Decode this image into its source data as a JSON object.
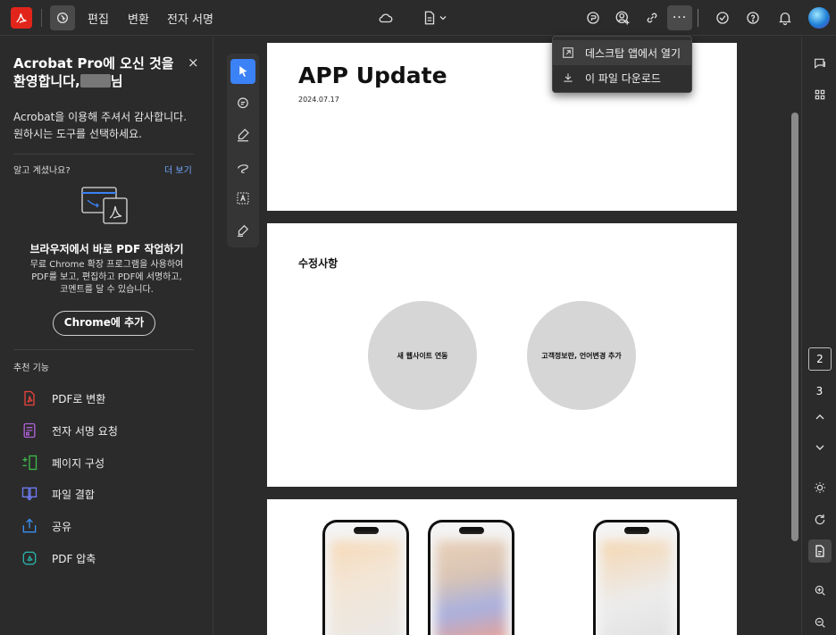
{
  "topbar": {
    "menu": [
      "편집",
      "변환",
      "전자 서명"
    ]
  },
  "dropdown": {
    "items": [
      "데스크탑 앱에서 열기",
      "이 파일 다운로드"
    ]
  },
  "left_panel": {
    "title_line1": "Acrobat Pro에 오신 것을",
    "title_line2_prefix": "환영합니다,",
    "title_line2_suffix": "님",
    "close": "×",
    "subtitle_line1": "Acrobat을 이용해 주셔서 감사합니다.",
    "subtitle_line2": "원하시는 도구를 선택하세요.",
    "did_you_know": "알고 계셨나요?",
    "see_more": "더 보기",
    "promo_title": "브라우저에서 바로 PDF 작업하기",
    "promo_line1": "무료 Chrome 확장 프로그램을 사용하여",
    "promo_line2": "PDF를 보고, 편집하고 PDF에 서명하고,",
    "promo_line3": "코멘트를 달 수 있습니다.",
    "chrome_button": "Chrome에 추가",
    "recommended_label": "추천 기능",
    "tools": [
      {
        "label": "PDF로 변환",
        "icon": "pdf-convert-icon",
        "color": "#e8453c"
      },
      {
        "label": "전자 서명 요청",
        "icon": "esign-request-icon",
        "color": "#b062d8"
      },
      {
        "label": "페이지 구성",
        "icon": "organize-pages-icon",
        "color": "#3fb84a"
      },
      {
        "label": "파일 결합",
        "icon": "combine-files-icon",
        "color": "#6e7bf2"
      },
      {
        "label": "공유",
        "icon": "share-icon",
        "color": "#3b8ff0"
      },
      {
        "label": "PDF 압축",
        "icon": "compress-pdf-icon",
        "color": "#29b1a6"
      }
    ]
  },
  "document": {
    "page1": {
      "title": "APP Update",
      "date": "2024.07.17"
    },
    "page2": {
      "heading": "수정사항",
      "circle1": "새 웹사이트 연동",
      "circle2": "고객정보란, 언어변경 추가"
    }
  },
  "right_rail": {
    "current_page": "2",
    "total_pages": "3"
  },
  "colors": {
    "accent": "#3b82f6",
    "brand": "#e1251b",
    "link": "#6fa8ff"
  }
}
